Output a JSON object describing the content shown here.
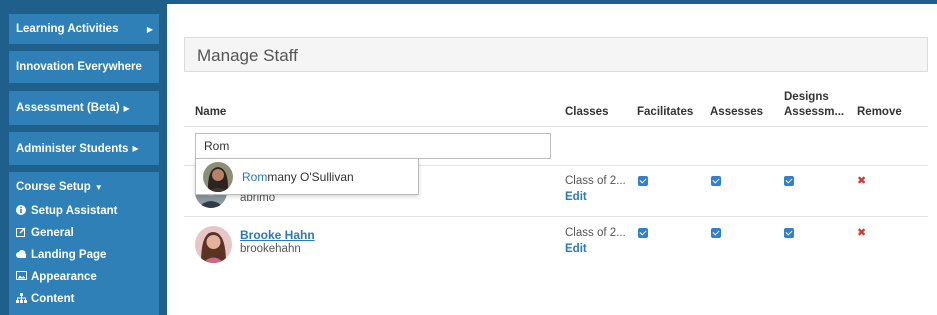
{
  "sidebar": {
    "learning_activities": "Learning Activities",
    "innovation_everywhere": "Innovation Everywhere",
    "assessment_beta": "Assessment (Beta)",
    "administer_students": "Administer Students",
    "course_setup": "Course Setup",
    "course_setup_items": [
      {
        "label": "Setup Assistant",
        "icon": "info-circle-icon"
      },
      {
        "label": "General",
        "icon": "edit-icon"
      },
      {
        "label": "Landing Page",
        "icon": "cloud-icon"
      },
      {
        "label": "Appearance",
        "icon": "image-icon"
      },
      {
        "label": "Content",
        "icon": "sitemap-icon"
      }
    ]
  },
  "header": {
    "title": "Manage Staff"
  },
  "table": {
    "columns": {
      "name": "Name",
      "classes": "Classes",
      "facilitates": "Facilitates",
      "assesses": "Assesses",
      "designs_line1": "Designs",
      "designs_line2": "Assessm...",
      "remove": "Remove"
    },
    "search": {
      "value": "Rom",
      "placeholder": ""
    },
    "suggestion": {
      "match": "Rom",
      "rest": "many O'Sullivan"
    },
    "rows": [
      {
        "name": "",
        "username": "abrimo",
        "classes": "Class of 2...",
        "edit": "Edit",
        "facilitates": true,
        "assesses": true,
        "designs": true
      },
      {
        "name": "Brooke Hahn",
        "username": "brookehahn",
        "classes": "Class of 2...",
        "edit": "Edit",
        "facilitates": true,
        "assesses": true,
        "designs": true
      }
    ]
  },
  "colors": {
    "sidebar_bg": "#1f5f8b",
    "sidebar_item": "#2f80b6",
    "link": "#2a7ab5",
    "checkbox": "#2f80d0",
    "remove": "#d9362c"
  }
}
